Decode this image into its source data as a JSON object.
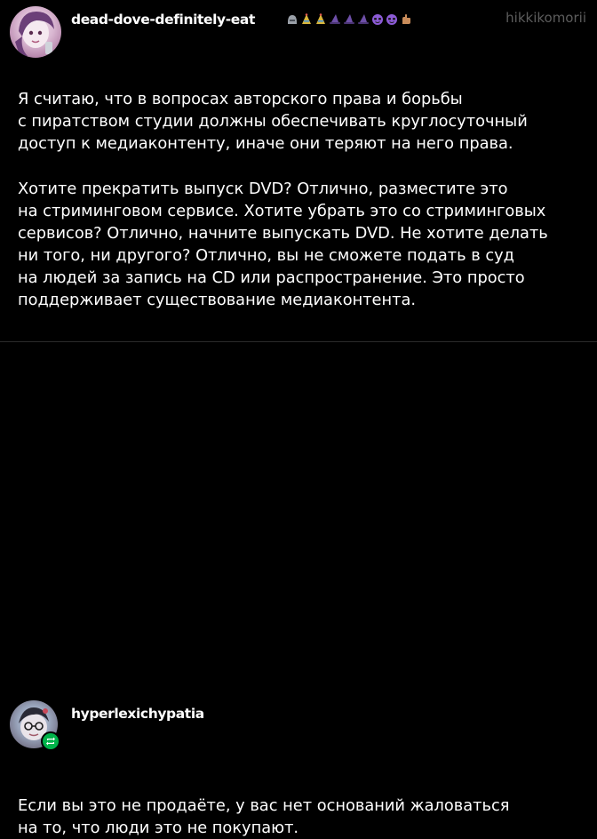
{
  "posts": [
    {
      "username": "dead-dove-definitely-eat",
      "watermark": "hikkikomorii",
      "badges": [
        {
          "icon": "helmet-icon",
          "color": "#9aa0a8"
        },
        {
          "icon": "party-hat-icon",
          "color": "#d8b63c"
        },
        {
          "icon": "party-hat-icon",
          "color": "#d8b63c"
        },
        {
          "icon": "witch-hat-icon",
          "color": "#6e4fa8"
        },
        {
          "icon": "witch-hat-icon",
          "color": "#6e4fa8"
        },
        {
          "icon": "witch-hat-icon",
          "color": "#6e4fa8"
        },
        {
          "icon": "smiley-glasses-icon",
          "color": "#8c5bd6"
        },
        {
          "icon": "smiley-glasses-icon",
          "color": "#8c5bd6"
        },
        {
          "icon": "hand-icon",
          "color": "#c98c5a"
        }
      ],
      "paragraphs": [
        [
          "Я считаю, что в вопросах авторского права и борьбы",
          "с пиратством студии должны обеспечивать круглосуточный",
          "доступ к медиаконтенту, иначе они теряют на него права."
        ],
        [
          "Хотите прекратить выпуск DVD? Отлично, разместите это",
          "на стриминговом сервисе. Хотите убрать это со стриминговых",
          "сервисов? Отлично, начните выпускать DVD. Не хотите делать",
          "ни того, ни другого? Отлично, вы не сможете подать в суд",
          "на людей за запись на CD или распространение. Это просто",
          "поддерживает существование медиаконтента."
        ]
      ]
    },
    {
      "username": "hyperlexichypatia",
      "reblog_badge_color": "#00b34a",
      "paragraphs": [
        [
          "Если вы это не продаёте, у вас нет оснований жаловаться",
          "на то, что люди это не покупают."
        ]
      ]
    }
  ]
}
